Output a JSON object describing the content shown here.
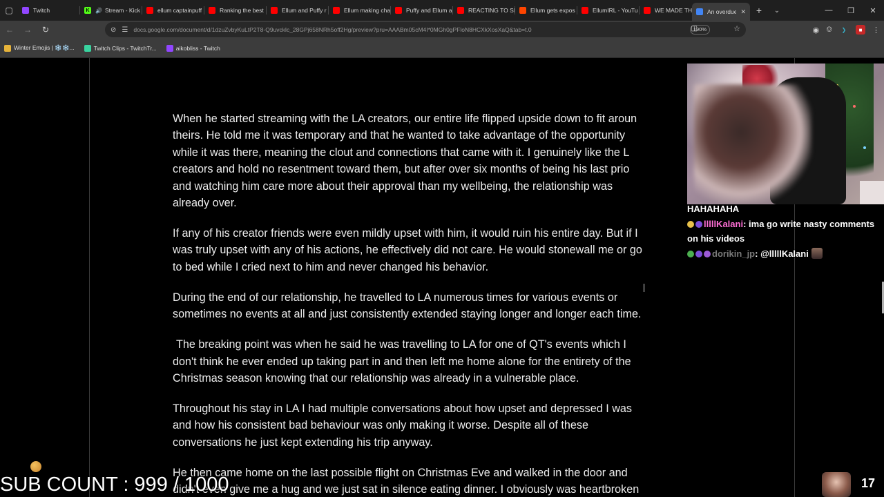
{
  "tabs": [
    {
      "label": "Twitch",
      "favicon": "twitch-icon",
      "active": false
    },
    {
      "label": "Stream - Kick",
      "favicon": "kick-icon",
      "active": false
    },
    {
      "label": "ellum captainpuff",
      "favicon": "youtube-icon",
      "active": false
    },
    {
      "label": "Ranking the best",
      "favicon": "youtube-icon",
      "active": false
    },
    {
      "label": "Ellum and Puffy r",
      "favicon": "youtube-icon",
      "active": false
    },
    {
      "label": "Ellum making cha",
      "favicon": "youtube-icon",
      "active": false
    },
    {
      "label": "Puffy and Ellum a",
      "favicon": "youtube-icon",
      "active": false
    },
    {
      "label": "REACTING TO SI",
      "favicon": "youtube-icon",
      "active": false
    },
    {
      "label": "Ellum gets expos",
      "favicon": "reddit-icon",
      "active": false
    },
    {
      "label": "EllumIRL - YouTu",
      "favicon": "youtube-icon",
      "active": false
    },
    {
      "label": "WE MADE THE W",
      "favicon": "youtube-icon",
      "active": false
    },
    {
      "label": "An overdue ex",
      "favicon": "docs-icon",
      "active": true
    }
  ],
  "toolbar": {
    "url": "docs.google.com/document/d/1dzuZvbyKuLtP2T8-Q9uvcklc_28GPj658NRh5off2Hg/preview?pru=AAABm05cM4I*0MGh0gPFloN8HCXkXosXaQ&tab=t.0",
    "zoom": "190%"
  },
  "bookmarks": [
    {
      "label": "Winter Emojis | ❄️❄️...",
      "icon": "folder-icon"
    },
    {
      "label": "Twitch Clips - TwitchTr...",
      "icon": "twitch-clips-icon"
    },
    {
      "label": "aikobliss - Twitch",
      "icon": "twitch-icon"
    }
  ],
  "document": {
    "paragraphs": [
      {
        "lines": [
          "When he started streaming with the LA creators, our entire life flipped upside down to fit aroun",
          "theirs. He told me it was temporary and that he wanted to take advantage of the opportunity",
          "while it was there, meaning the clout and connections that came with it. I genuinely like the L",
          "creators and hold no resentment toward them, but after over six months of being his last prio",
          "and watching him care more about their approval than my wellbeing, the relationship was",
          "already over."
        ]
      },
      {
        "lines": [
          "If any of his creator friends were even mildly upset with him, it would ruin his entire day. But if I",
          "was truly upset with any of his actions, he effectively did not care. He would stonewall me or go",
          "to bed while I cried next to him and never changed his behavior."
        ]
      },
      {
        "lines": [
          "During the end of our relationship, he travelled to LA numerous times for various events or",
          "sometimes no events at all and just consistently extended staying longer and longer each time."
        ]
      },
      {
        "lines": [
          "The breaking point was when he said he was travelling to LA for one of QT's events which I",
          "don't think he ever ended up taking part in and then left me home alone for the entirety of the",
          "Christmas season knowing that our relationship was already in a vulnerable place."
        ]
      },
      {
        "lines": [
          "Throughout his stay in LA I had multiple conversations about how upset and depressed I was",
          "and how his consistent bad behaviour was only making it worse. Despite all of these",
          "conversations he just kept extending his trip anyway."
        ]
      },
      {
        "lines": [
          "He then came home on the last possible flight on Christmas Eve and walked in the door and",
          "didn't even give me a hug and we just sat in silence eating dinner. I obviously was heartbroken"
        ]
      }
    ]
  },
  "chat": {
    "messages": [
      {
        "user": "",
        "text": "HAHAHAHA"
      },
      {
        "user": "lllllKalani",
        "text": "ima go write nasty comments on his videos"
      },
      {
        "user": "dorikin_jp",
        "text": "@lllllKalani"
      }
    ]
  },
  "overlay": {
    "sub_count": "SUB COUNT : 999 / 1000",
    "viewer_count": "17"
  }
}
